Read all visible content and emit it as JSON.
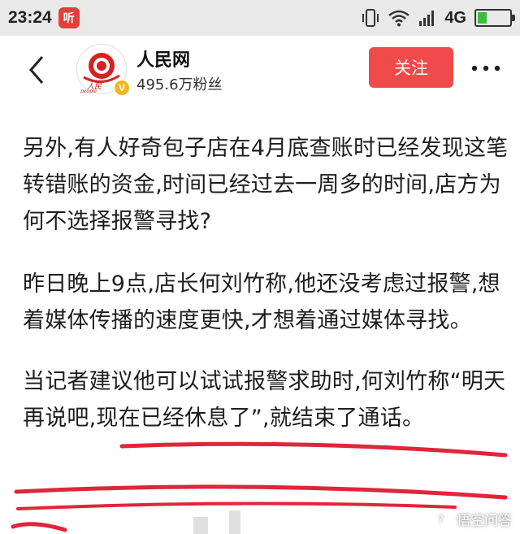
{
  "status_bar": {
    "time": "23:24",
    "app_badge": "听",
    "network": "4G",
    "battery_level": 0.3
  },
  "header": {
    "account_name": "人民网",
    "fans": "495.6万粉丝",
    "follow_label": "关注",
    "avatar_badge": "V",
    "avatar_logo_text": "人民",
    "avatar_logo_sub": "people"
  },
  "article": {
    "paragraphs": [
      "另外,有人好奇包子店在4月底查账时已经发现这笔转错账的资金,时间已经过去一周多的时间,店方为何不选择报警寻找?",
      "昨日晚上9点,店长何刘竹称,他还没考虑过报警,想着媒体传播的速度更快,才想着通过媒体寻找。",
      "当记者建议他可以试试报警求助时,何刘竹称“明天再说吧,现在已经休息了”,就结束了通话。"
    ]
  },
  "watermark": {
    "text": "悟空问答"
  },
  "colors": {
    "accent": "#f04a4a",
    "scribble": "#e0263a",
    "status_bar_bg": "#e9e9e9"
  }
}
